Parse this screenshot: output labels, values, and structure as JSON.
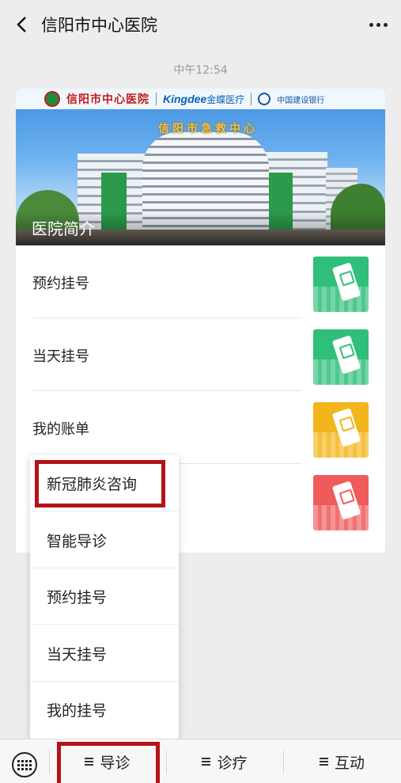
{
  "header": {
    "title": "信阳市中心医院",
    "back_icon": "chevron-left-icon",
    "more_icon": "more-dots-icon"
  },
  "chat": {
    "timestamp": "中午12:54"
  },
  "card": {
    "banner": {
      "logos": {
        "hospital": "信阳市中心医院",
        "kingdee": "Kingdee",
        "kingdee_cn": "金蝶医疗",
        "bank": "中国建设银行"
      },
      "building_sign": "信阳市急救中心",
      "title": "医院简介"
    },
    "items": [
      {
        "label": "预约挂号",
        "thumb_color": "#2fbf7a",
        "icon": "mobile-registration-icon"
      },
      {
        "label": "当天挂号",
        "thumb_color": "#2fbf7a",
        "icon": "mobile-registration-icon"
      },
      {
        "label": "我的账单",
        "thumb_color": "#f3b51c",
        "icon": "mobile-bill-icon"
      },
      {
        "label": "",
        "thumb_color": "#ef5a5a",
        "icon": "mobile-report-icon"
      }
    ]
  },
  "popup_menu": {
    "items": [
      {
        "label": "新冠肺炎咨询",
        "highlighted": true
      },
      {
        "label": "智能导诊"
      },
      {
        "label": "预约挂号"
      },
      {
        "label": "当天挂号"
      },
      {
        "label": "我的挂号"
      }
    ]
  },
  "bottom_bar": {
    "keyboard_icon": "keyboard-icon",
    "tabs": [
      {
        "label": "导诊",
        "active": true
      },
      {
        "label": "诊疗"
      },
      {
        "label": "互动"
      }
    ]
  },
  "colors": {
    "highlight": "#b3131a",
    "green": "#2fbf7a",
    "yellow": "#f3b51c",
    "red": "#ef5a5a",
    "background": "#ededed"
  }
}
